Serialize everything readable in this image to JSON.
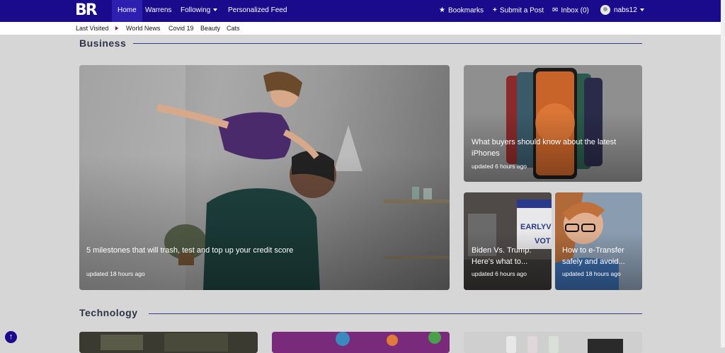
{
  "nav": {
    "logo": "BR",
    "home": "Home",
    "warrens": "Warrens",
    "following": "Following",
    "personalized": "Personalized Feed",
    "bookmarks": "Bookmarks",
    "submit": "Submit a Post",
    "inbox": "Inbox (0)",
    "user": "nabs12"
  },
  "subnav": {
    "last_visited": "Last Visited",
    "items": [
      "World News",
      "Covid 19",
      "Beauty",
      "Cats"
    ]
  },
  "sections": {
    "business": {
      "title": "Business",
      "cards": [
        {
          "title": "5 milestones that will trash, test and top up your credit score",
          "time": "updated 18 hours ago"
        },
        {
          "title": "What buyers should know about the latest iPhones",
          "time": "updated 6 hours ago"
        },
        {
          "title": "Biden Vs. Trump: Here's what to...",
          "time": "updated 6 hours ago"
        },
        {
          "title": "How to e-Transfer safely and avoid...",
          "time": "updated 18 hours ago"
        }
      ]
    },
    "technology": {
      "title": "Technology"
    }
  },
  "colors": {
    "navbar": "#1a0b8c",
    "page_bg": "#d6d6d6",
    "heading": "#2c3446"
  },
  "icons": [
    "star-icon",
    "plus-icon",
    "envelope-icon",
    "chevron-down-icon",
    "arrow-up-icon"
  ]
}
